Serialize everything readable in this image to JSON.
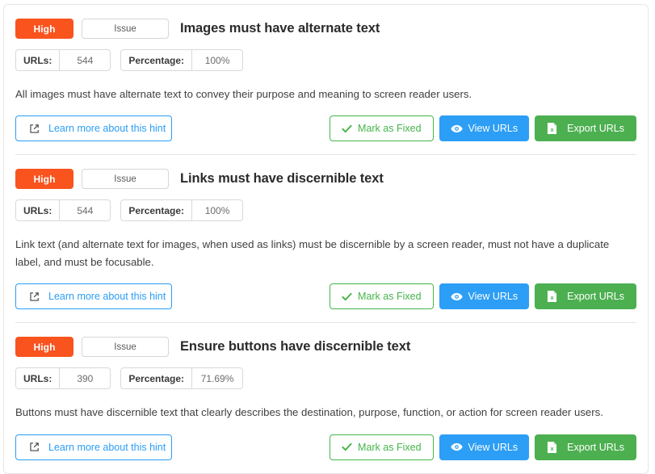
{
  "card": {
    "hints": [
      {
        "severity_label": "High",
        "type_label": "Issue",
        "title": "Images must have alternate text",
        "stats": [
          {
            "label": "URLs:",
            "value": "544"
          },
          {
            "label": "Percentage:",
            "value": "100%"
          }
        ],
        "description": "All images must have alternate text to convey their purpose and meaning to screen reader users.",
        "actions": {
          "learn_more": "Learn more about this hint",
          "mark_fixed": "Mark as Fixed",
          "view_urls": "View URLs",
          "export_urls": "Export URLs"
        }
      },
      {
        "severity_label": "High",
        "type_label": "Issue",
        "title": "Links must have discernible text",
        "stats": [
          {
            "label": "URLs:",
            "value": "544"
          },
          {
            "label": "Percentage:",
            "value": "100%"
          }
        ],
        "description": "Link text (and alternate text for images, when used as links) must be discernible by a screen reader, must not have a duplicate label, and must be focusable.",
        "actions": {
          "learn_more": "Learn more about this hint",
          "mark_fixed": "Mark as Fixed",
          "view_urls": "View URLs",
          "export_urls": "Export URLs"
        }
      },
      {
        "severity_label": "High",
        "type_label": "Issue",
        "title": "Ensure buttons have discernible text",
        "stats": [
          {
            "label": "URLs:",
            "value": "390"
          },
          {
            "label": "Percentage:",
            "value": "71.69%"
          }
        ],
        "description": "Buttons must have discernible text that clearly describes the destination, purpose, function, or action for screen reader users.",
        "actions": {
          "learn_more": "Learn more about this hint",
          "mark_fixed": "Mark as Fixed",
          "view_urls": "View URLs",
          "export_urls": "Export URLs"
        }
      }
    ]
  },
  "icons": {
    "learn_more": "external-link-icon",
    "mark_fixed": "check-icon",
    "view_urls": "eye-icon",
    "export_urls": "excel-file-icon"
  },
  "colors": {
    "severity_high": "#f9531e",
    "view_urls": "#2c9ef5",
    "export_urls": "#4caf50",
    "mark_fixed": "#45b549",
    "link": "#2c9ef5"
  }
}
